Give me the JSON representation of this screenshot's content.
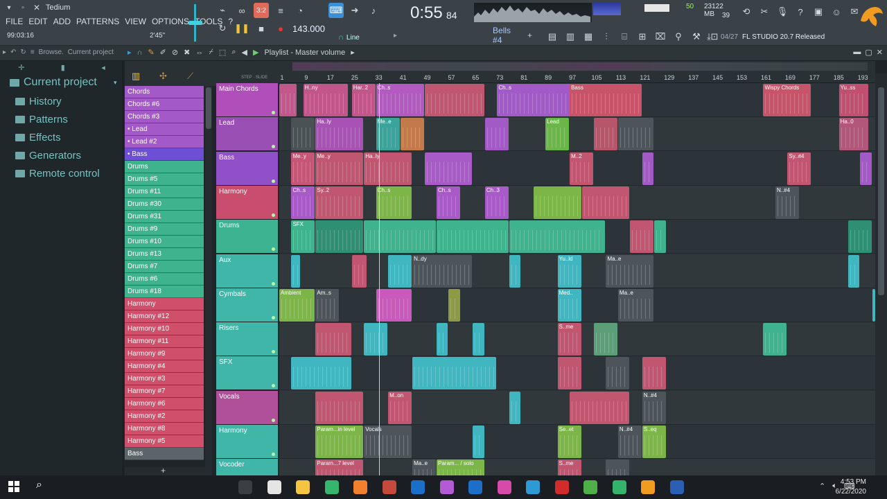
{
  "app": {
    "title": "Tedium",
    "song_time": "0:55",
    "song_time_frac": "84",
    "time_label": "M:S:CS",
    "tempo": "143.000",
    "counter_left": "99:03:16",
    "counter_right": "2'45\"",
    "snap": "Line",
    "pattern_name": "Bells #4",
    "hint_count": "04/27",
    "hint_text": "FL STUDIO 20.7 Released",
    "cpu": "50",
    "memory": "23122 MB",
    "polyphony": "39"
  },
  "menu": [
    "FILE",
    "EDIT",
    "ADD",
    "PATTERNS",
    "VIEW",
    "OPTIONS",
    "TOOLS",
    "?"
  ],
  "browser": {
    "header": "Browse.",
    "header_scope": "Current project",
    "items": [
      "Current project",
      "History",
      "Patterns",
      "Effects",
      "Generators",
      "Remote control"
    ]
  },
  "playlist": {
    "title": "Playlist - Master volume",
    "ruler": [
      "1",
      "9",
      "17",
      "25",
      "33",
      "41",
      "49",
      "57",
      "65",
      "73",
      "81",
      "89",
      "97",
      "105",
      "113",
      "121",
      "129",
      "137",
      "145",
      "153",
      "161",
      "169",
      "177",
      "185",
      "193"
    ]
  },
  "patterns": [
    {
      "label": "Chords",
      "color": "#a35ac8"
    },
    {
      "label": "Chords #6",
      "color": "#a35ac8"
    },
    {
      "label": "Chords #3",
      "color": "#a35ac8"
    },
    {
      "label": "• Lead",
      "color": "#a35ac8"
    },
    {
      "label": "• Lead #2",
      "color": "#a35ac8"
    },
    {
      "label": "• Bass",
      "color": "#6d4fd6"
    },
    {
      "label": "Drums",
      "color": "#3fb38e"
    },
    {
      "label": "Drums #5",
      "color": "#3fb38e"
    },
    {
      "label": "Drums #11",
      "color": "#3fb38e"
    },
    {
      "label": "Drums #30",
      "color": "#3fb38e"
    },
    {
      "label": "Drums #31",
      "color": "#3fb38e"
    },
    {
      "label": "Drums #9",
      "color": "#3fb38e"
    },
    {
      "label": "Drums #10",
      "color": "#3fb38e"
    },
    {
      "label": "Drums #13",
      "color": "#3fb38e"
    },
    {
      "label": "Drums #7",
      "color": "#3fb38e"
    },
    {
      "label": "Drums #6",
      "color": "#3fb38e"
    },
    {
      "label": "Drums #18",
      "color": "#3fb38e"
    },
    {
      "label": "Harmony",
      "color": "#d04f6b"
    },
    {
      "label": "Harmony #12",
      "color": "#d04f6b"
    },
    {
      "label": "Harmony #10",
      "color": "#d04f6b"
    },
    {
      "label": "Harmony #11",
      "color": "#d04f6b"
    },
    {
      "label": "Harmony #9",
      "color": "#d04f6b"
    },
    {
      "label": "Harmony #4",
      "color": "#d04f6b"
    },
    {
      "label": "Harmony #3",
      "color": "#d04f6b"
    },
    {
      "label": "Harmony #7",
      "color": "#d04f6b"
    },
    {
      "label": "Harmony #6",
      "color": "#d04f6b"
    },
    {
      "label": "Harmony #2",
      "color": "#d04f6b"
    },
    {
      "label": "Harmony #8",
      "color": "#d04f6b"
    },
    {
      "label": "Harmony #5",
      "color": "#d04f6b"
    },
    {
      "label": "Bass",
      "color": "#5b6468"
    }
  ],
  "tracks": [
    {
      "label": "Main Chords",
      "color": "#b04fb9"
    },
    {
      "label": "Lead",
      "color": "#9a4fb4"
    },
    {
      "label": "Bass",
      "color": "#9050c8"
    },
    {
      "label": "Harmony",
      "color": "#c94e6d"
    },
    {
      "label": "Drums",
      "color": "#3eb391"
    },
    {
      "label": "Aux",
      "color": "#3fb6a8"
    },
    {
      "label": "Cymbals",
      "color": "#3fb6a8"
    },
    {
      "label": "Risers",
      "color": "#3fb6a8"
    },
    {
      "label": "SFX",
      "color": "#3fb6a8"
    },
    {
      "label": "Vocals",
      "color": "#b04f9a"
    },
    {
      "label": "Harmony",
      "color": "#3fb6a8"
    },
    {
      "label": "Vocoder",
      "color": "#3fb6a8"
    }
  ],
  "clips": [
    {
      "lane": 0,
      "start": 1,
      "len": 6,
      "color": "#c2578c",
      "label": ""
    },
    {
      "lane": 0,
      "start": 9,
      "len": 15,
      "color": "#c0568a",
      "label": "H..ny"
    },
    {
      "lane": 0,
      "start": 25,
      "len": 8,
      "color": "#c0568a",
      "label": "Har..2"
    },
    {
      "lane": 0,
      "start": 33,
      "len": 16,
      "color": "#b25ac0",
      "label": "Ch..s"
    },
    {
      "lane": 0,
      "start": 49,
      "len": 20,
      "color": "#c0566f",
      "label": ""
    },
    {
      "lane": 0,
      "start": 73,
      "len": 25,
      "color": "#a15ac8",
      "label": "Ch..s"
    },
    {
      "lane": 0,
      "start": 97,
      "len": 24,
      "color": "#c75468",
      "label": "Bass"
    },
    {
      "lane": 0,
      "start": 161,
      "len": 16,
      "color": "#c75468",
      "label": "Wispy Chords"
    },
    {
      "lane": 0,
      "start": 186,
      "len": 10,
      "color": "#c04f70",
      "label": "Yu..ss"
    },
    {
      "lane": 1,
      "start": 5,
      "len": 8,
      "color": "#4a5256",
      "label": ""
    },
    {
      "lane": 1,
      "start": 13,
      "len": 16,
      "color": "#a952b6",
      "label": "Ha..ly"
    },
    {
      "lane": 1,
      "start": 33,
      "len": 8,
      "color": "#3aa39a",
      "label": "Me..e"
    },
    {
      "lane": 1,
      "start": 41,
      "len": 8,
      "color": "#c27a4c",
      "label": ""
    },
    {
      "lane": 1,
      "start": 69,
      "len": 8,
      "color": "#a25ac4",
      "label": ""
    },
    {
      "lane": 1,
      "start": 89,
      "len": 8,
      "color": "#6bb649",
      "label": "Lead"
    },
    {
      "lane": 1,
      "start": 105,
      "len": 8,
      "color": "#b7566a",
      "label": ""
    },
    {
      "lane": 1,
      "start": 113,
      "len": 12,
      "color": "#4d555a",
      "label": ""
    },
    {
      "lane": 1,
      "start": 186,
      "len": 10,
      "color": "#b2567a",
      "label": "Ha..0"
    },
    {
      "lane": 2,
      "start": 5,
      "len": 8,
      "color": "#c45677",
      "label": "Me..y"
    },
    {
      "lane": 2,
      "start": 13,
      "len": 16,
      "color": "#c0566f",
      "label": "Me..y"
    },
    {
      "lane": 2,
      "start": 29,
      "len": 16,
      "color": "#c0566f",
      "label": "Ha..ly"
    },
    {
      "lane": 2,
      "start": 49,
      "len": 16,
      "color": "#a85ac6",
      "label": ""
    },
    {
      "lane": 2,
      "start": 97,
      "len": 8,
      "color": "#c0566f",
      "label": "M..2"
    },
    {
      "lane": 2,
      "start": 121,
      "len": 4,
      "color": "#a45ac6",
      "label": ""
    },
    {
      "lane": 2,
      "start": 169,
      "len": 8,
      "color": "#c0566f",
      "label": "Sy..#4"
    },
    {
      "lane": 2,
      "start": 193,
      "len": 4,
      "color": "#a45ac6",
      "label": ""
    },
    {
      "lane": 3,
      "start": 5,
      "len": 8,
      "color": "#a85ac6",
      "label": "Ch..s"
    },
    {
      "lane": 3,
      "start": 13,
      "len": 16,
      "color": "#c0566f",
      "label": "Sy..2"
    },
    {
      "lane": 3,
      "start": 33,
      "len": 12,
      "color": "#7db648",
      "label": "Ch..s"
    },
    {
      "lane": 3,
      "start": 53,
      "len": 8,
      "color": "#a85ac6",
      "label": "Ch..s"
    },
    {
      "lane": 3,
      "start": 69,
      "len": 8,
      "color": "#a85ac6",
      "label": "Ch..3"
    },
    {
      "lane": 3,
      "start": 85,
      "len": 16,
      "color": "#7db648",
      "label": ""
    },
    {
      "lane": 3,
      "start": 101,
      "len": 16,
      "color": "#c0566f",
      "label": ""
    },
    {
      "lane": 3,
      "start": 165,
      "len": 8,
      "color": "#4d555a",
      "label": "N..#4"
    },
    {
      "lane": 4,
      "start": 5,
      "len": 8,
      "color": "#3fb38e",
      "label": "SFX"
    },
    {
      "lane": 4,
      "start": 13,
      "len": 16,
      "color": "#2f8f73",
      "label": ""
    },
    {
      "lane": 4,
      "start": 29,
      "len": 24,
      "color": "#3fb38e",
      "label": ""
    },
    {
      "lane": 4,
      "start": 53,
      "len": 24,
      "color": "#3fb38e",
      "label": ""
    },
    {
      "lane": 4,
      "start": 77,
      "len": 32,
      "color": "#3fb38e",
      "label": ""
    },
    {
      "lane": 4,
      "start": 117,
      "len": 8,
      "color": "#c0566f",
      "label": ""
    },
    {
      "lane": 4,
      "start": 125,
      "len": 4,
      "color": "#3fb38e",
      "label": ""
    },
    {
      "lane": 4,
      "start": 189,
      "len": 8,
      "color": "#2f8f73",
      "label": ""
    },
    {
      "lane": 5,
      "start": 5,
      "len": 3,
      "color": "#3fb6c0",
      "label": ""
    },
    {
      "lane": 5,
      "start": 25,
      "len": 5,
      "color": "#c0566f",
      "label": ""
    },
    {
      "lane": 5,
      "start": 37,
      "len": 8,
      "color": "#3fb6c0",
      "label": ""
    },
    {
      "lane": 5,
      "start": 45,
      "len": 20,
      "color": "#4d555a",
      "label": "N..dy"
    },
    {
      "lane": 5,
      "start": 77,
      "len": 4,
      "color": "#3fb6c0",
      "label": ""
    },
    {
      "lane": 5,
      "start": 93,
      "len": 8,
      "color": "#3fb6c0",
      "label": "Yu..ld"
    },
    {
      "lane": 5,
      "start": 109,
      "len": 16,
      "color": "#4d555a",
      "label": "Ma..e"
    },
    {
      "lane": 5,
      "start": 189,
      "len": 4,
      "color": "#3fb6c0",
      "label": ""
    },
    {
      "lane": 6,
      "start": 1,
      "len": 12,
      "color": "#7db648",
      "label": "Ambient"
    },
    {
      "lane": 6,
      "start": 13,
      "len": 8,
      "color": "#4d555a",
      "label": "Am..s"
    },
    {
      "lane": 6,
      "start": 33,
      "len": 12,
      "color": "#c95abc",
      "label": ""
    },
    {
      "lane": 6,
      "start": 57,
      "len": 4,
      "color": "#8c9a45",
      "label": ""
    },
    {
      "lane": 6,
      "start": 93,
      "len": 8,
      "color": "#3fb6c0",
      "label": "Med.."
    },
    {
      "lane": 6,
      "start": 113,
      "len": 12,
      "color": "#4d555a",
      "label": "Ma..e"
    },
    {
      "lane": 6,
      "start": 197,
      "len": 1,
      "color": "#3fb6c0",
      "label": ""
    },
    {
      "lane": 7,
      "start": 13,
      "len": 12,
      "color": "#c0566f",
      "label": ""
    },
    {
      "lane": 7,
      "start": 29,
      "len": 8,
      "color": "#3fb6c0",
      "label": ""
    },
    {
      "lane": 7,
      "start": 53,
      "len": 4,
      "color": "#3fb6c0",
      "label": ""
    },
    {
      "lane": 7,
      "start": 65,
      "len": 4,
      "color": "#3fb6c0",
      "label": ""
    },
    {
      "lane": 7,
      "start": 93,
      "len": 8,
      "color": "#c0566f",
      "label": "S..me"
    },
    {
      "lane": 7,
      "start": 105,
      "len": 8,
      "color": "#5b9e77",
      "label": ""
    },
    {
      "lane": 7,
      "start": 161,
      "len": 8,
      "color": "#3fb38e",
      "label": ""
    },
    {
      "lane": 8,
      "start": 5,
      "len": 20,
      "color": "#3fb6c0",
      "label": ""
    },
    {
      "lane": 8,
      "start": 45,
      "len": 28,
      "color": "#3fb6c0",
      "label": ""
    },
    {
      "lane": 8,
      "start": 93,
      "len": 8,
      "color": "#c0566f",
      "label": ""
    },
    {
      "lane": 8,
      "start": 109,
      "len": 8,
      "color": "#4d555a",
      "label": ""
    },
    {
      "lane": 8,
      "start": 121,
      "len": 8,
      "color": "#c0566f",
      "label": ""
    },
    {
      "lane": 9,
      "start": 13,
      "len": 16,
      "color": "#c0566f",
      "label": ""
    },
    {
      "lane": 9,
      "start": 37,
      "len": 8,
      "color": "#c0566f",
      "label": "M..on"
    },
    {
      "lane": 9,
      "start": 77,
      "len": 4,
      "color": "#3fb6c0",
      "label": ""
    },
    {
      "lane": 9,
      "start": 97,
      "len": 20,
      "color": "#c0566f",
      "label": ""
    },
    {
      "lane": 9,
      "start": 121,
      "len": 8,
      "color": "#4d555a",
      "label": "N..#4"
    },
    {
      "lane": 10,
      "start": 13,
      "len": 16,
      "color": "#7db648",
      "label": "Param...in level"
    },
    {
      "lane": 10,
      "start": 29,
      "len": 16,
      "color": "#4d555a",
      "label": "Vocals"
    },
    {
      "lane": 10,
      "start": 65,
      "len": 4,
      "color": "#3fb6c0",
      "label": ""
    },
    {
      "lane": 10,
      "start": 93,
      "len": 8,
      "color": "#7db648",
      "label": "Se..et"
    },
    {
      "lane": 10,
      "start": 113,
      "len": 8,
      "color": "#4d555a",
      "label": "N..#4"
    },
    {
      "lane": 10,
      "start": 121,
      "len": 8,
      "color": "#7db648",
      "label": "S..eq"
    },
    {
      "lane": 11,
      "start": 13,
      "len": 16,
      "color": "#c0566f",
      "label": "Param...7 level"
    },
    {
      "lane": 11,
      "start": 45,
      "len": 8,
      "color": "#4d555a",
      "label": "Ma..e"
    },
    {
      "lane": 11,
      "start": 53,
      "len": 16,
      "color": "#7db648",
      "label": "Param... / solo"
    },
    {
      "lane": 11,
      "start": 93,
      "len": 8,
      "color": "#c0566f",
      "label": "S..me"
    },
    {
      "lane": 11,
      "start": 109,
      "len": 8,
      "color": "#4d555a",
      "label": ""
    }
  ],
  "taskbar": {
    "time": "4:53 PM",
    "date": "6/22/2020",
    "apps": [
      "#3a3f44",
      "#e5e5e5",
      "#f5c542",
      "#36b56c",
      "#f07f2e",
      "#c64a3c",
      "#1b6fc9",
      "#b35ad6",
      "#1b6fc9",
      "#d64aa8",
      "#2d9ad6",
      "#d12b2b",
      "#4fb04a",
      "#34b36b",
      "#f29b21",
      "#2b5fb3"
    ]
  }
}
